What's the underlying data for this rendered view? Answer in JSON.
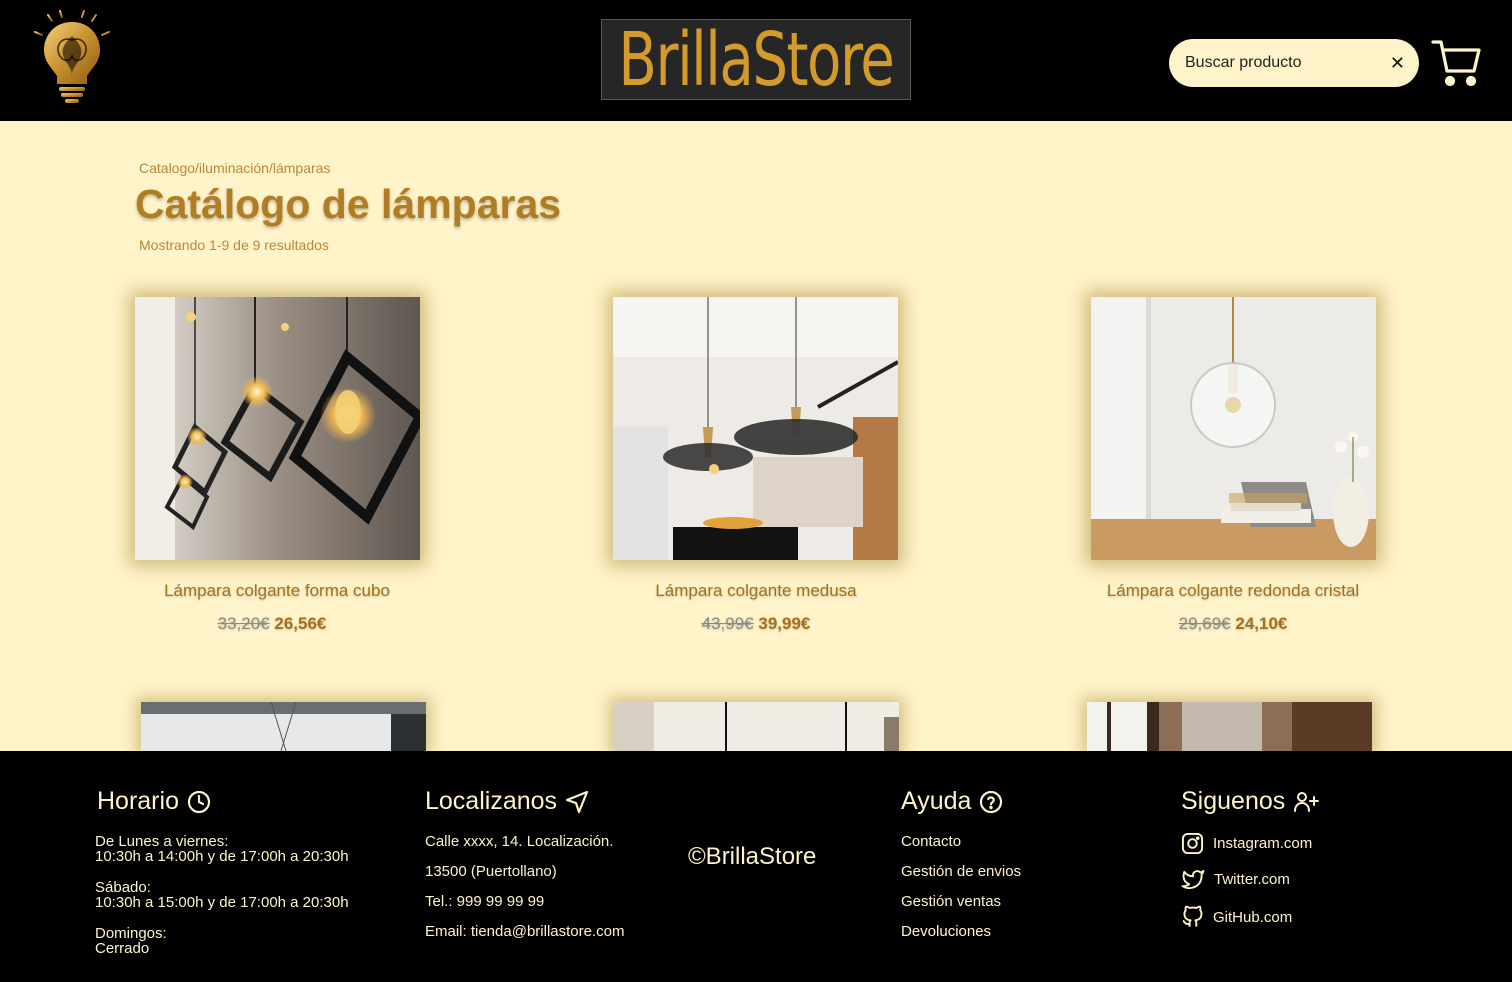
{
  "header": {
    "brand": "BrillaStore",
    "search": {
      "placeholder": "Buscar producto",
      "clear_label": "✕"
    }
  },
  "main": {
    "breadcrumb": "Catalogo/iluminación/lámparas",
    "title": "Catálogo de lámparas",
    "results": "Mostrando 1-9 de 9 resultados",
    "products": [
      {
        "name": "Lámpara colgante forma cubo",
        "old_price": "33,20€",
        "price": "26,56€"
      },
      {
        "name": "Lámpara colgante medusa",
        "old_price": "43,99€",
        "price": "39,99€"
      },
      {
        "name": "Lámpara colgante redonda cristal",
        "old_price": "29,69€",
        "price": "24,10€"
      }
    ]
  },
  "footer": {
    "horario": {
      "title": "Horario",
      "weekday_label": "De Lunes a viernes:",
      "weekday_hours": "10:30h a 14:00h y de 17:00h a 20:30h",
      "saturday_label": "Sábado:",
      "saturday_hours": "10:30h a 15:00h y de 17:00h a 20:30h",
      "sunday_label": "Domingos:",
      "sunday_hours": "Cerrado"
    },
    "localizanos": {
      "title": "Localizanos",
      "address": "Calle xxxx, 14. Localización.",
      "city": "13500 (Puertollano)",
      "phone": "Tel.: 999 99 99 99",
      "email": "Email: tienda@brillastore.com"
    },
    "copyright": "©BrillaStore",
    "ayuda": {
      "title": "Ayuda",
      "links": [
        "Contacto",
        "Gestión de envios",
        "Gestión ventas",
        "Devoluciones"
      ]
    },
    "siguenos": {
      "title": "Siguenos",
      "links": [
        "Instagram.com",
        "Twitter.com",
        "GitHub.com"
      ]
    }
  },
  "colors": {
    "background": "#fff3c9",
    "gold": "#d39b2b",
    "title": "#b07d24",
    "header_bg": "#000000"
  }
}
